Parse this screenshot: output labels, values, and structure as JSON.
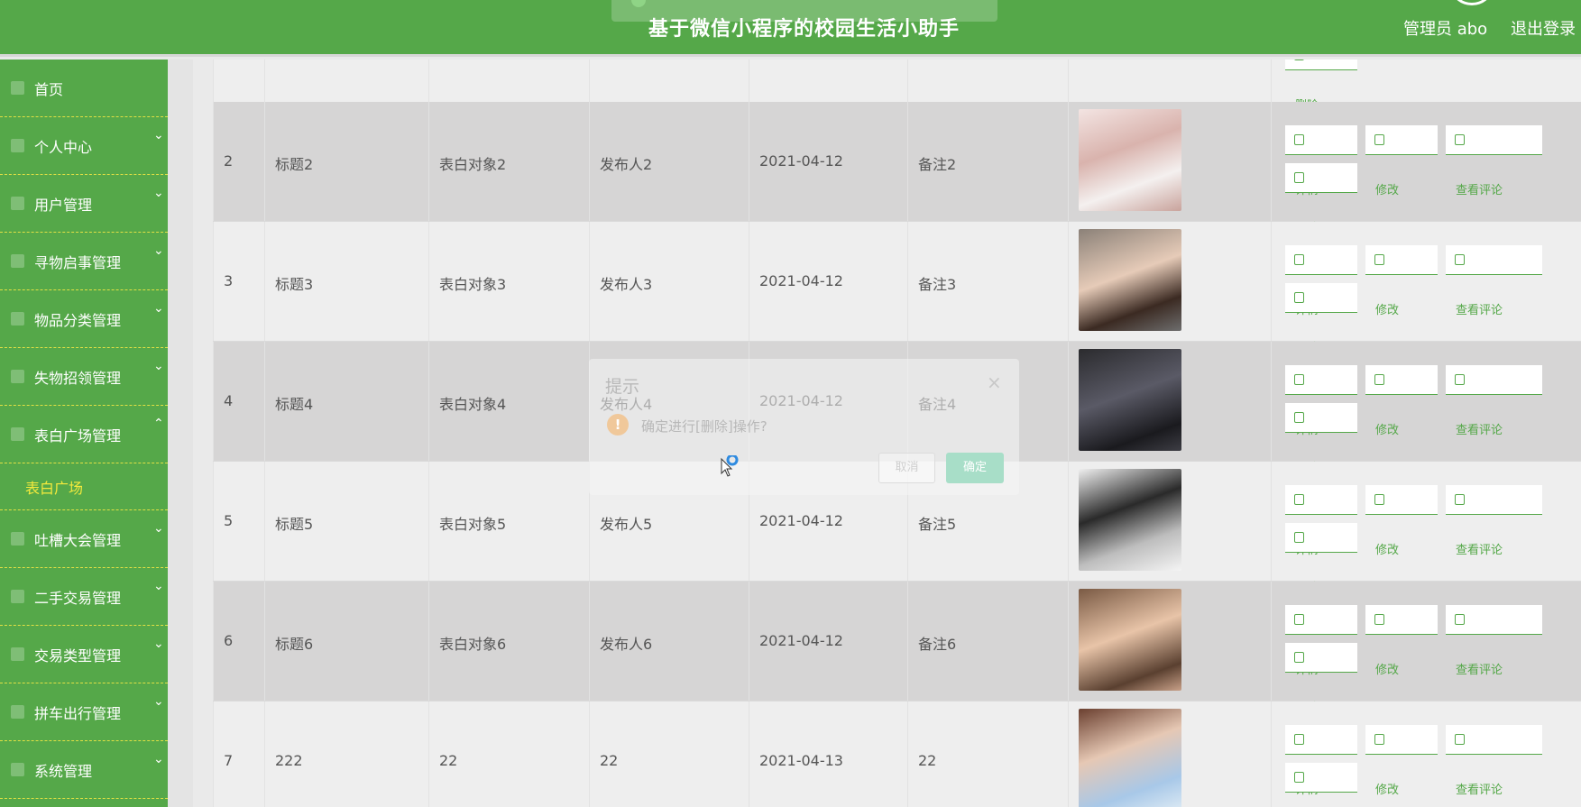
{
  "header": {
    "title": "基于微信小程序的校园生活小助手",
    "user": "管理员 abo",
    "logout": "退出登录"
  },
  "sidebar": {
    "items": [
      {
        "label": "首页",
        "icon": "home-icon",
        "expandable": false
      },
      {
        "label": "个人中心",
        "icon": "person-icon",
        "expandable": true
      },
      {
        "label": "用户管理",
        "icon": "user-icon",
        "expandable": true
      },
      {
        "label": "寻物启事管理",
        "icon": "search-item-icon",
        "expandable": true
      },
      {
        "label": "物品分类管理",
        "icon": "category-icon",
        "expandable": true
      },
      {
        "label": "失物招领管理",
        "icon": "list-icon",
        "expandable": true
      },
      {
        "label": "表白广场管理",
        "icon": "grid-icon",
        "expandable": true,
        "expanded": true
      },
      {
        "label": "吐槽大会管理",
        "icon": "filter-icon",
        "expandable": true
      },
      {
        "label": "二手交易管理",
        "icon": "trade-icon",
        "expandable": true
      },
      {
        "label": "交易类型管理",
        "icon": "type-icon",
        "expandable": true
      },
      {
        "label": "拼车出行管理",
        "icon": "car-icon",
        "expandable": true
      },
      {
        "label": "系统管理",
        "icon": "system-icon",
        "expandable": true
      }
    ],
    "submenu_active": "表白广场"
  },
  "table": {
    "top_row_partial_button": "删除",
    "rows": [
      {
        "id": "2",
        "title": "标题2",
        "target": "表白对象2",
        "publisher": "发布人2",
        "date": "2021-04-12",
        "note": "备注2",
        "alt": true
      },
      {
        "id": "3",
        "title": "标题3",
        "target": "表白对象3",
        "publisher": "发布人3",
        "date": "2021-04-12",
        "note": "备注3",
        "alt": false
      },
      {
        "id": "4",
        "title": "标题4",
        "target": "表白对象4",
        "publisher": "发布人4",
        "date": "2021-04-12",
        "note": "备注4",
        "alt": true
      },
      {
        "id": "5",
        "title": "标题5",
        "target": "表白对象5",
        "publisher": "发布人5",
        "date": "2021-04-12",
        "note": "备注5",
        "alt": false
      },
      {
        "id": "6",
        "title": "标题6",
        "target": "表白对象6",
        "publisher": "发布人6",
        "date": "2021-04-12",
        "note": "备注6",
        "alt": true
      },
      {
        "id": "7",
        "title": "222",
        "target": "22",
        "publisher": "22",
        "date": "2021-04-13",
        "note": "22",
        "alt": false
      }
    ],
    "actions": {
      "detail": "详情",
      "edit": "修改",
      "comments": "查看评论",
      "delete": "删除"
    }
  },
  "modal": {
    "title": "提示",
    "message": "确定进行[删除]操作?",
    "cancel": "取消",
    "confirm": "确定"
  },
  "colors": {
    "primary": "#55a849",
    "active_submenu": "#f4ea3d",
    "row_alt": "#d6d5d5",
    "row_plain": "#eeeeee"
  }
}
